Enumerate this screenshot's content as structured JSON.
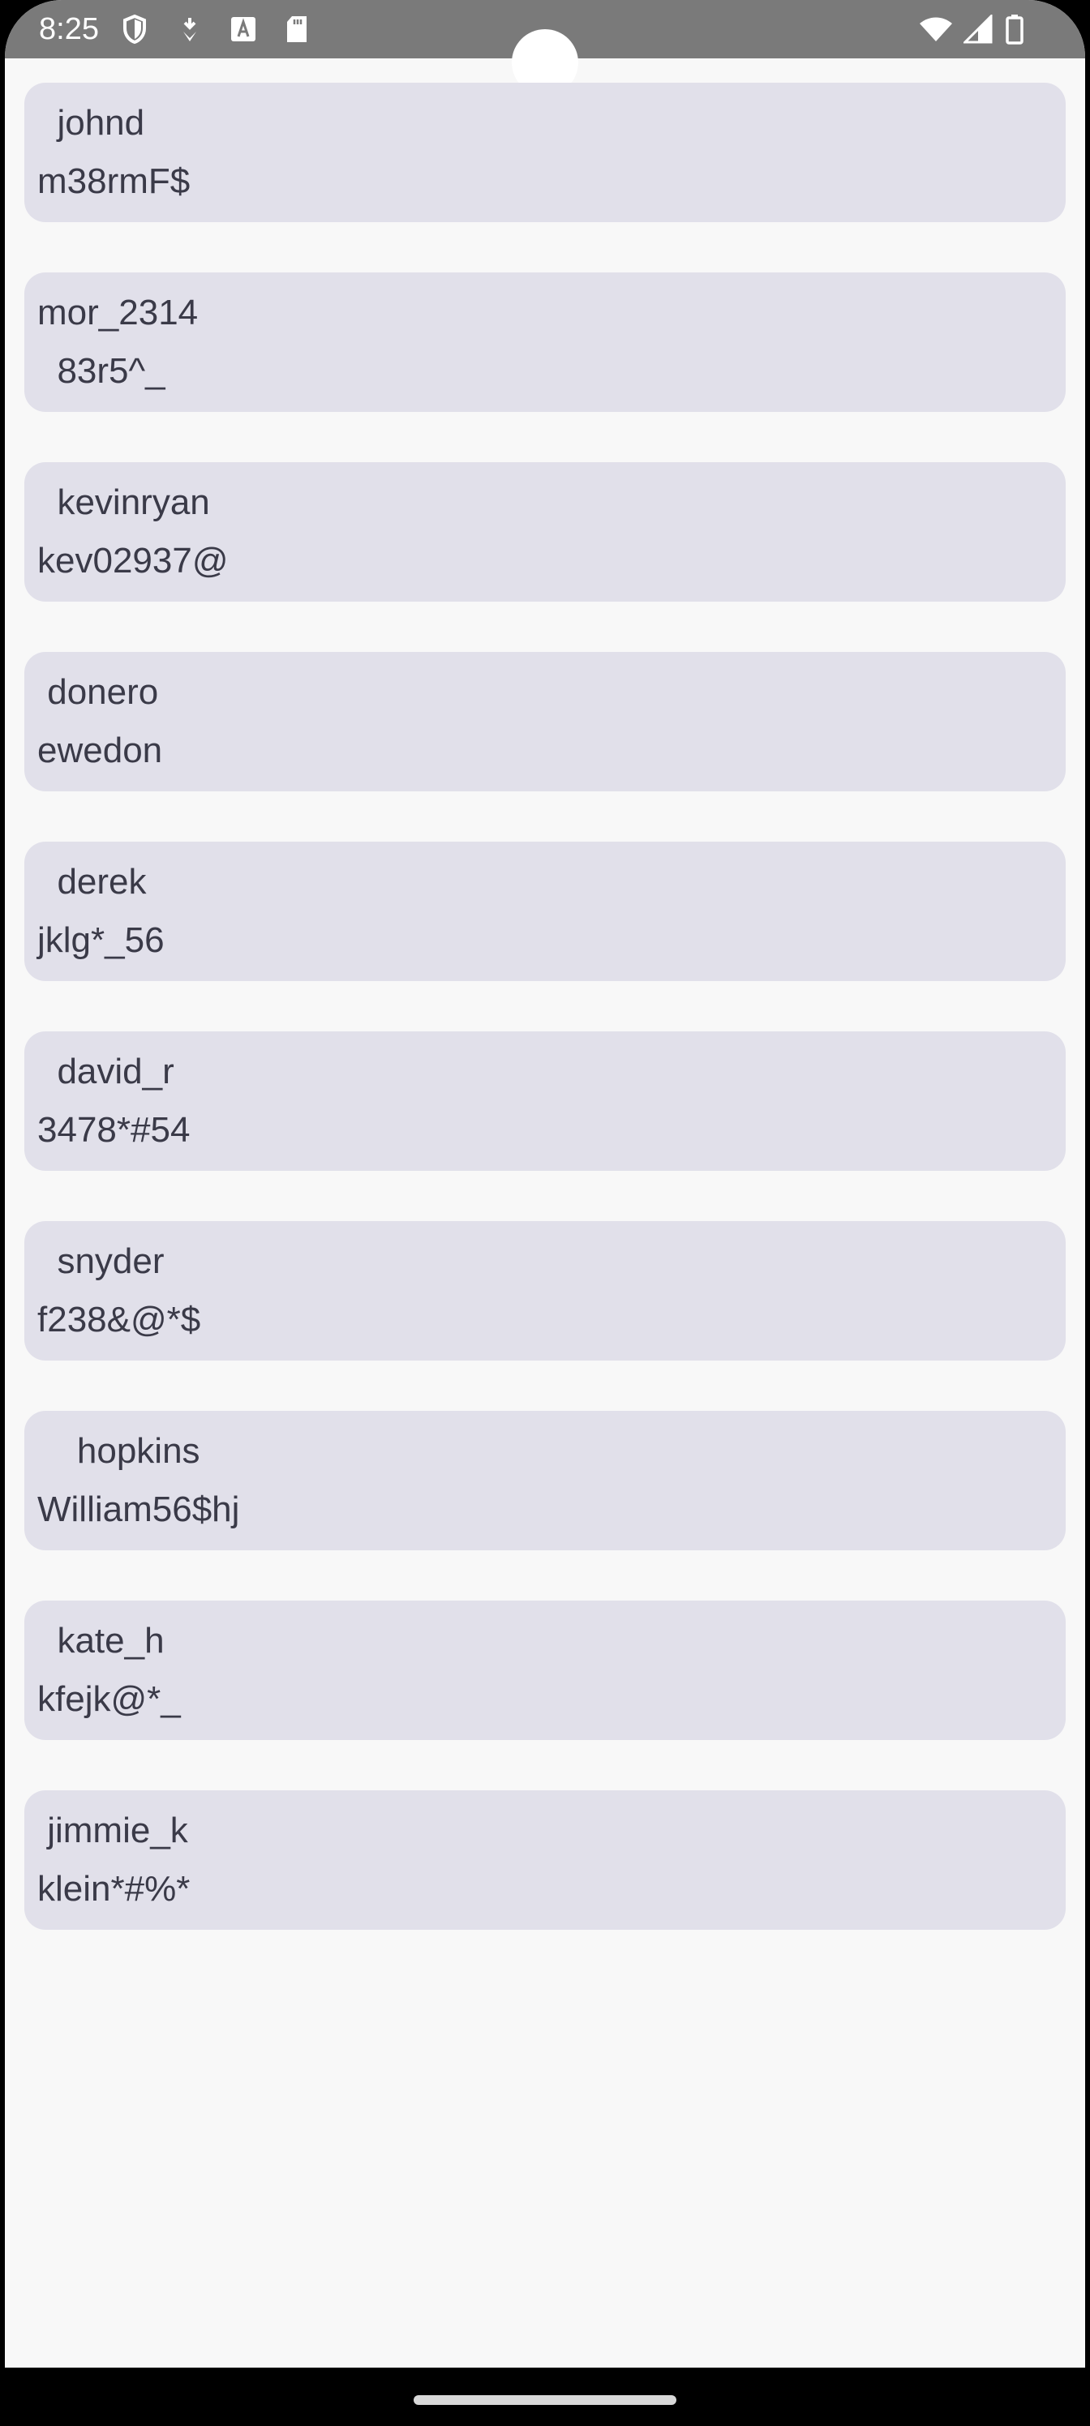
{
  "status_bar": {
    "time": "8:25",
    "icons_left": [
      "shield-icon",
      "download-icon",
      "font-icon",
      "sd-card-icon"
    ],
    "icons_right": [
      "wifi-icon",
      "cell-signal-icon",
      "battery-icon"
    ]
  },
  "accounts": [
    {
      "username": "  johnd",
      "password": "m38rmF$"
    },
    {
      "username": "mor_2314",
      "password": "  83r5^_"
    },
    {
      "username": "  kevinryan",
      "password": "kev02937@"
    },
    {
      "username": " donero",
      "password": "ewedon"
    },
    {
      "username": "  derek",
      "password": "jklg*_56"
    },
    {
      "username": "  david_r",
      "password": "3478*#54"
    },
    {
      "username": "  snyder",
      "password": "f238&@*$"
    },
    {
      "username": "    hopkins",
      "password": "William56$hj"
    },
    {
      "username": "  kate_h",
      "password": "kfejk@*_"
    },
    {
      "username": " jimmie_k",
      "password": "klein*#%*"
    }
  ],
  "colors": {
    "status_bar": "#7a7a7a",
    "background": "#f8f8f8",
    "card": "#e1e0ea",
    "text": "#3a3a48"
  }
}
